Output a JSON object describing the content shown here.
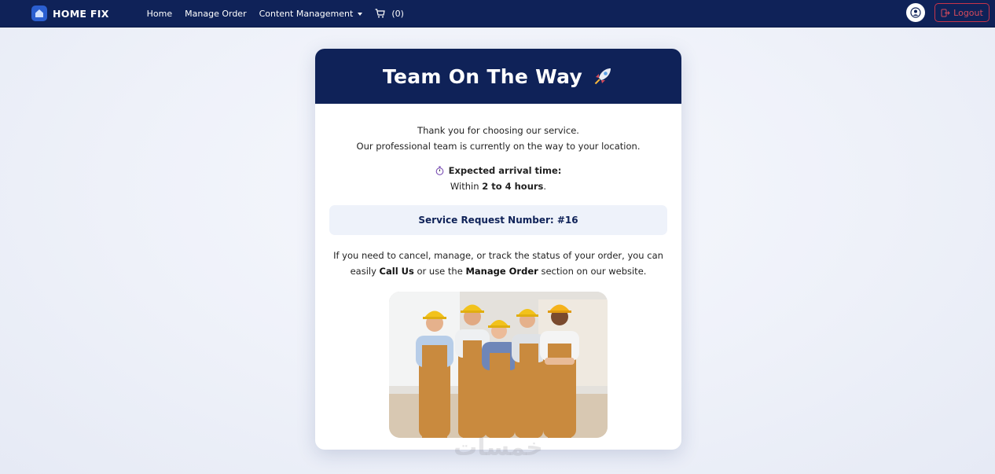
{
  "navbar": {
    "brand": "HOME FIX",
    "links": {
      "home": "Home",
      "manage_order": "Manage Order",
      "content_management": "Content Management"
    },
    "cart_count": "(0)",
    "logout_label": "Logout"
  },
  "card": {
    "title": "Team On The Way",
    "intro_line1": "Thank you for choosing our service.",
    "intro_line2": "Our professional team is currently on the way to your location.",
    "eta_label": "Expected arrival time:",
    "eta_prefix": "Within",
    "eta_value": "2 to 4 hours",
    "eta_suffix": ".",
    "request_number": "Service Request Number: #16",
    "help_part1": "If you need to cancel, manage, or track the status of your order, you can easily",
    "help_call": "Call Us",
    "help_part2": "or use the",
    "help_manage": "Manage Order",
    "help_part3": "section on our website."
  },
  "watermark": "خمسات",
  "colors": {
    "navbar": "#0f2258",
    "accent": "#2b5fd0",
    "logout": "#c8344a",
    "helmet": "#f2c21b",
    "overalls": "#c98a3e"
  },
  "icons": [
    "house-icon",
    "cart-icon",
    "user-icon",
    "logout-icon",
    "rocket-icon",
    "stopwatch-icon"
  ]
}
